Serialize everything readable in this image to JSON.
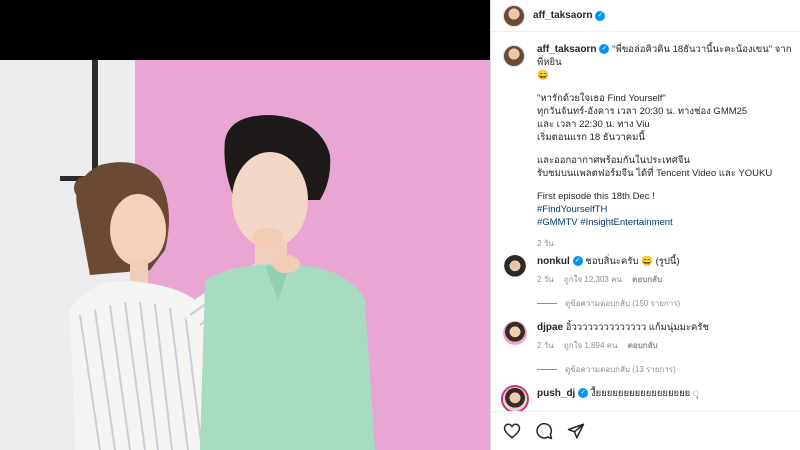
{
  "post": {
    "username": "aff_taksaorn",
    "verified_icon": "verified-badge-icon",
    "caption_lead": "\"พี่ขอล่อคิวคิน 18ธันวานี้นะคะน้องเขน\" จาก พี่หยิน",
    "caption_emoji": "😄",
    "caption_line1": "\"หารักด้วยใจเธอ Find Yourself\"",
    "caption_line2": "ทุกวันจันทร์-อังคาร เวลา 20:30 น. ทางช่อง GMM25",
    "caption_line3": "และ เวลา 22:30 น. ทาง Viu",
    "caption_line4": "เริ่มตอนแรก 18 ธันวาคมนี้",
    "caption_line5": "และออกอากาศพร้อมกันในประเทศจีน",
    "caption_line6": "รับชมบนแพลตฟอร์มจีน ได้ที่ Tencent Video และ YOUKU",
    "caption_line7": "First episode this 18th Dec !",
    "hashtag1": "#FindYourselfTH",
    "hashtag2": "#GMMTV",
    "hashtag3": "#InsightEntertainment",
    "time": "2 วัน"
  },
  "comments": [
    {
      "username": "nonkul",
      "verified": true,
      "text": "ชอบสิ่นะครับ 😄 (รูปนี้)",
      "time": "2 วัน",
      "likes": "ถูกใจ 12,303 คน",
      "reply_label": "ตอบกลับ",
      "view_replies": "ดูข้อความตอบกลับ (150 รายการ)"
    },
    {
      "username": "djpae",
      "verified": false,
      "text": "อิ้วววววววววววววว แก้มนุ่มมะครัช",
      "time": "2 วัน",
      "likes": "ถูกใจ 1,894 คน",
      "reply_label": "ตอบกลับ",
      "view_replies": "ดูข้อความตอบกลับ (13 รายการ)"
    },
    {
      "username": "push_dj",
      "verified": true,
      "text": "งื้ยยยยยยยยยยยยยยยยย ◌ุ"
    }
  ],
  "actions": {
    "like": "heart-icon",
    "comment": "comment-icon",
    "share": "share-icon"
  },
  "colors": {
    "backdrop_pink": "#e9a6d2",
    "link": "#00376b",
    "verified": "#0095f6",
    "muted": "#8e8e8e"
  }
}
